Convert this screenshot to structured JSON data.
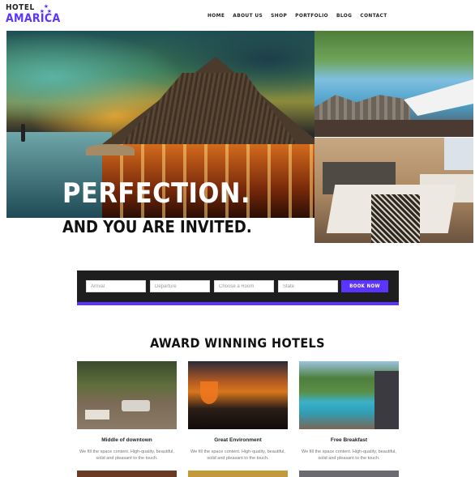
{
  "logo": {
    "line1": "HOTEL",
    "line2": "AMARICA",
    "stars": [
      "★",
      "★",
      "★"
    ]
  },
  "nav": {
    "items": [
      "HOME",
      "ABOUT US",
      "SHOP",
      "PORTFOLIO",
      "BLOG",
      "CONTACT"
    ]
  },
  "hero": {
    "title": "PERFECTION.",
    "subtitle": "AND YOU ARE INVITED."
  },
  "booking": {
    "arrival_placeholder": "Arrival",
    "departure_placeholder": "Departure",
    "room_placeholder": "Choose a Room",
    "state_placeholder": "State",
    "button_label": "BOOK NOW"
  },
  "section": {
    "title": "AWARD WINNING HOTELS",
    "cards": [
      {
        "title": "Middle of downtown",
        "text": "We fill the space content. High-quality, beautiful, solid and pleasant to the touch."
      },
      {
        "title": "Great Environment",
        "text": "We fill the space content. High-quality, beautiful, solid and pleasant to the touch."
      },
      {
        "title": "Free Breakfast",
        "text": "We fill the space content. High-quality, beautiful, solid and pleasant to the touch."
      }
    ]
  },
  "colors": {
    "accent": "#5b35ff",
    "booking_bg": "#1e1e1e"
  }
}
